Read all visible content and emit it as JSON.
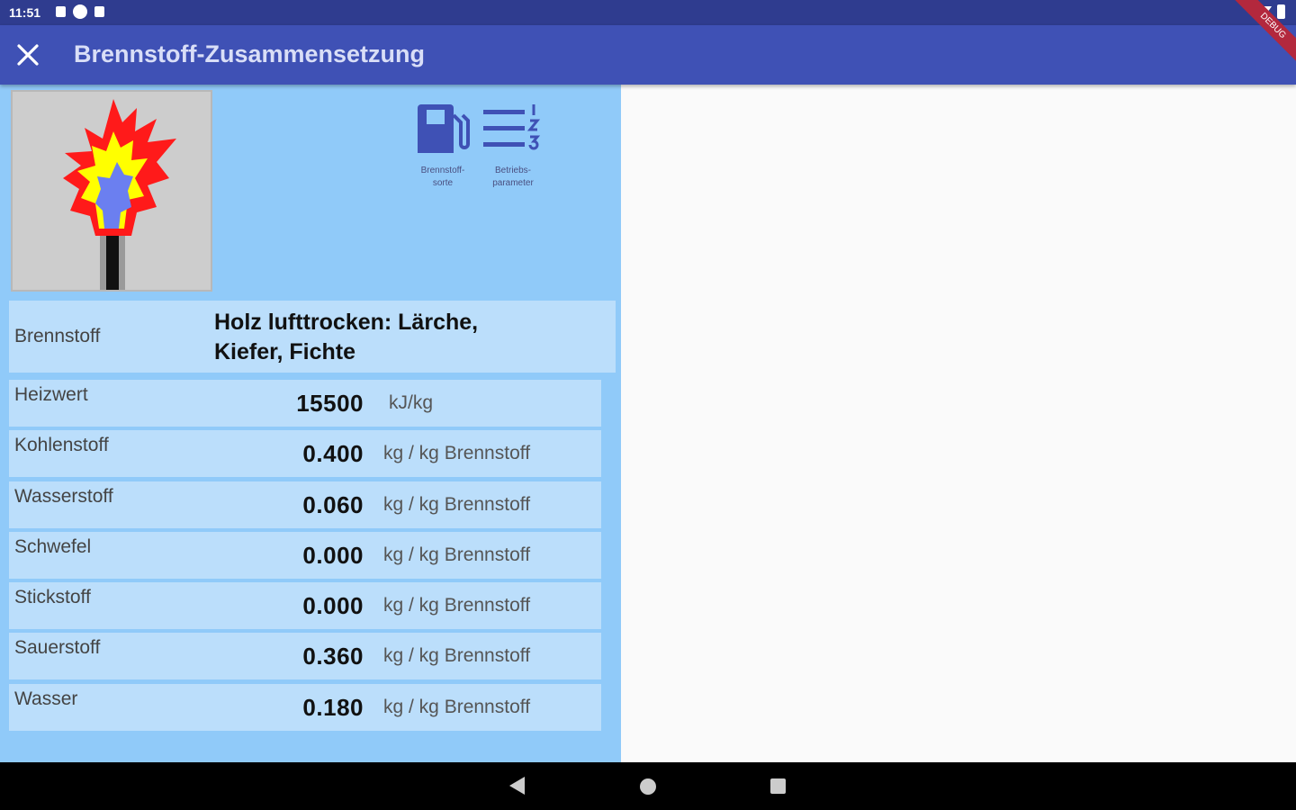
{
  "status_bar": {
    "time": "11:51"
  },
  "debug_ribbon": {
    "label": "DEBUG"
  },
  "appbar": {
    "title": "Brennstoff-Zusammensetzung"
  },
  "toolbar": {
    "buttons": [
      {
        "label_line1": "Brennstoff-",
        "label_line2": "sorte",
        "icon": "fuel-pump-icon"
      },
      {
        "label_line1": "Betriebs-",
        "label_line2": "parameter",
        "icon": "numbered-list-icon"
      }
    ]
  },
  "fuel": {
    "label": "Brennstoff",
    "value_line1": "Holz lufttrocken: Lärche,",
    "value_line2": "Kiefer, Fichte"
  },
  "rows": [
    {
      "label": "Heizwert",
      "value": "15500",
      "unit": "kJ/kg"
    },
    {
      "label": "Kohlenstoff",
      "value": "0.400",
      "unit": "kg / kg Brennstoff"
    },
    {
      "label": "Wasserstoff",
      "value": "0.060",
      "unit": "kg / kg Brennstoff"
    },
    {
      "label": "Schwefel",
      "value": "0.000",
      "unit": "kg / kg Brennstoff"
    },
    {
      "label": "Stickstoff",
      "value": "0.000",
      "unit": "kg / kg Brennstoff"
    },
    {
      "label": "Sauerstoff",
      "value": "0.360",
      "unit": "kg / kg Brennstoff"
    },
    {
      "label": "Wasser",
      "value": "0.180",
      "unit": "kg / kg Brennstoff"
    }
  ],
  "colors": {
    "appbar": "#3f51b5",
    "statusbar": "#2f3c8f",
    "left_pane": "#90caf9",
    "row_bg": "#bbdefb",
    "icon": "#3f51b5"
  }
}
